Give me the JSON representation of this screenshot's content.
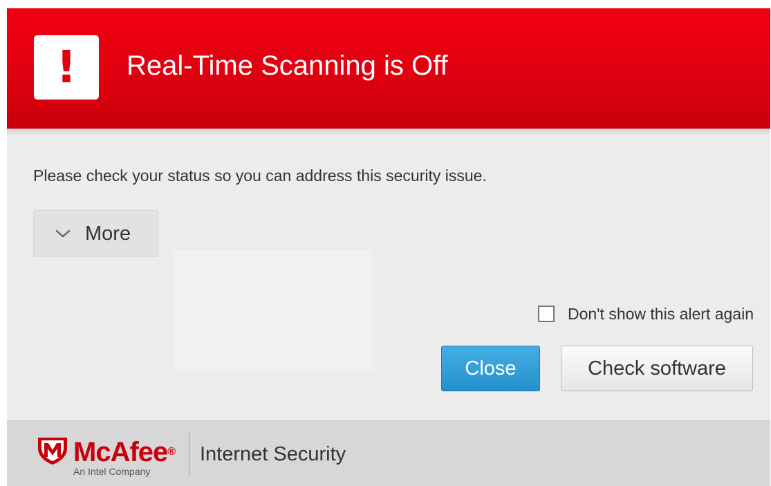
{
  "header": {
    "alert_icon": "exclamation-icon",
    "title": "Real-Time Scanning is Off",
    "accent_color": "#e0000f"
  },
  "body": {
    "message": "Please check your status so you can address this security issue.",
    "more_button": {
      "label": "More",
      "icon": "chevron-down-icon"
    },
    "dont_show_checkbox": {
      "label": "Don't show this alert again",
      "checked": false
    }
  },
  "actions": {
    "close_label": "Close",
    "check_software_label": "Check software",
    "primary_color": "#2690cc"
  },
  "footer": {
    "brand": "McAfee",
    "brand_mark": "®",
    "tagline": "An Intel Company",
    "product": "Internet Security",
    "logo_icon": "mcafee-shield-icon"
  }
}
